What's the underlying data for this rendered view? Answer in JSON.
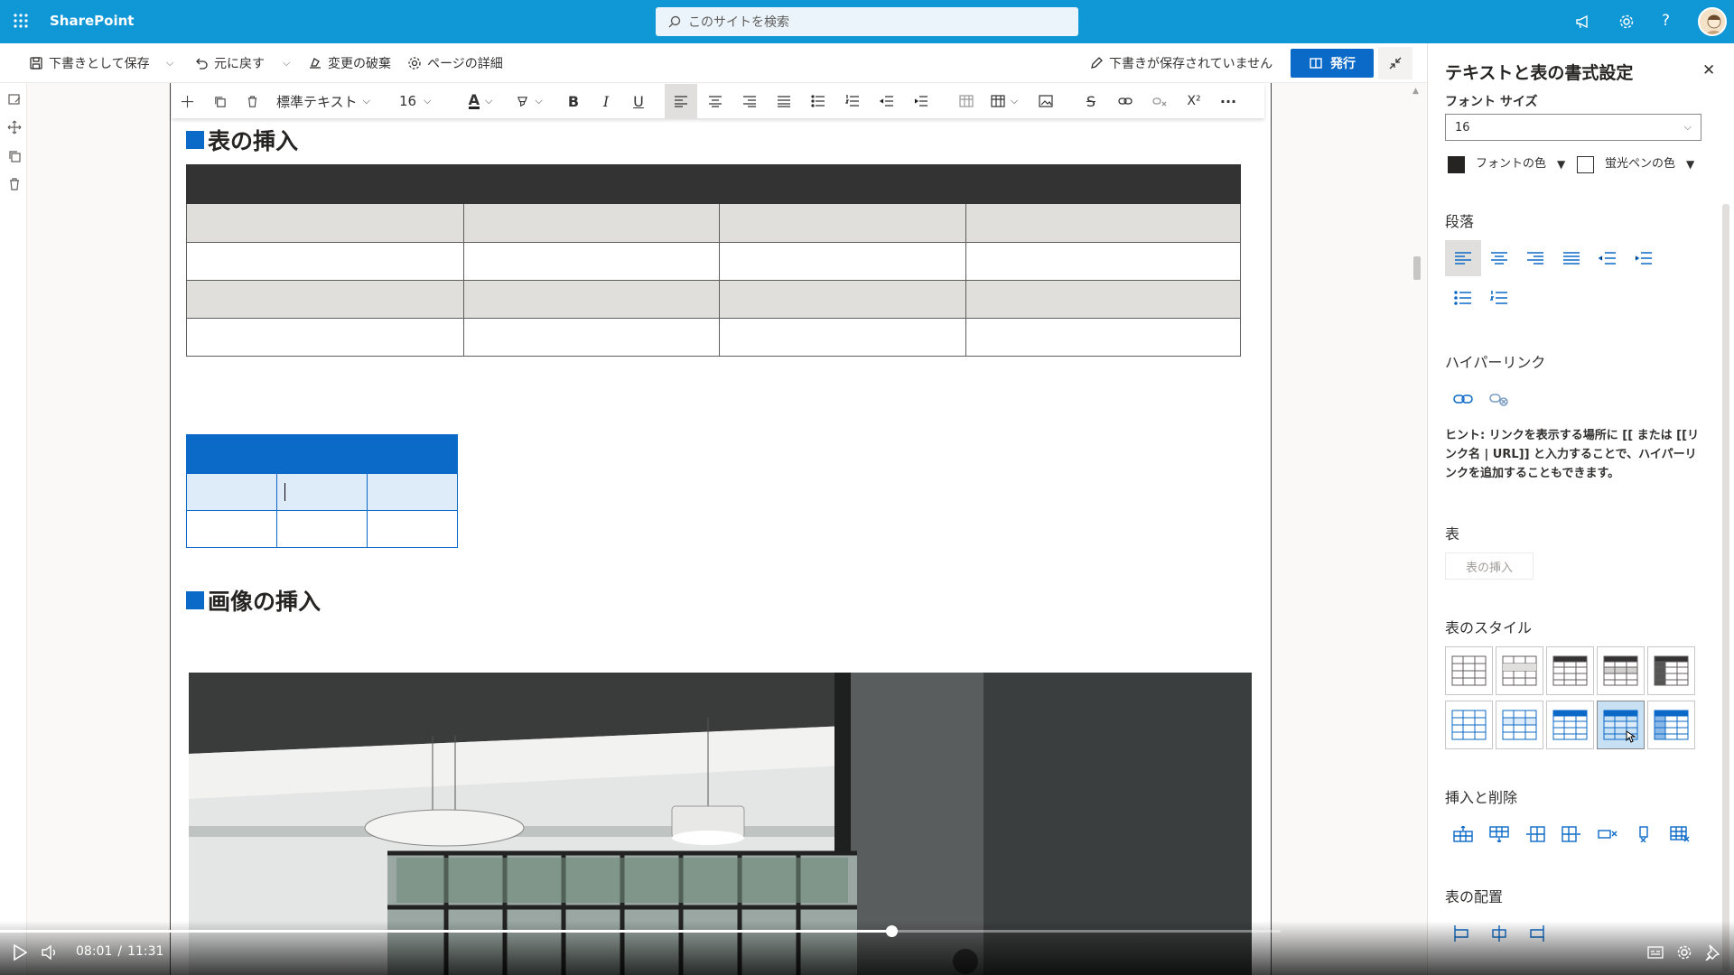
{
  "app": {
    "name": "SharePoint",
    "search_placeholder": "このサイトを検索"
  },
  "commandbar": {
    "save_draft": "下書きとして保存",
    "undo": "元に戻す",
    "discard": "変更の破棄",
    "page_details": "ページの詳細",
    "draft_status": "下書きが保存されていません",
    "publish": "発行"
  },
  "toolbar": {
    "style": "標準テキスト",
    "font_size": "16"
  },
  "content": {
    "heading_table": "表の挿入",
    "heading_image": "画像の挿入"
  },
  "panel": {
    "title": "テキストと表の書式設定",
    "font_size_label": "フォント サイズ",
    "font_size_value": "16",
    "font_color_label": "フォントの色",
    "highlight_label": "蛍光ペンの色",
    "paragraph_label": "段落",
    "hyperlink_label": "ハイパーリンク",
    "hint": "ヒント: リンクを表示する場所に [[ または [[リンク名 | URL]] と入力することで、ハイパーリンクを追加することもできます。",
    "table_label": "表",
    "insert_table_button": "表の挿入",
    "table_style_label": "表のスタイル",
    "insert_delete_label": "挿入と削除",
    "table_align_label": "表の配置"
  },
  "player": {
    "current": "08:01",
    "separator": "/",
    "total": "11:31",
    "progress": 0.696
  },
  "colors": {
    "topbar": "#0f97d6",
    "accent": "#0b69c7",
    "header_dark": "#333333",
    "row_gray": "#e0dfdc",
    "row_blue": "#deecf9"
  }
}
